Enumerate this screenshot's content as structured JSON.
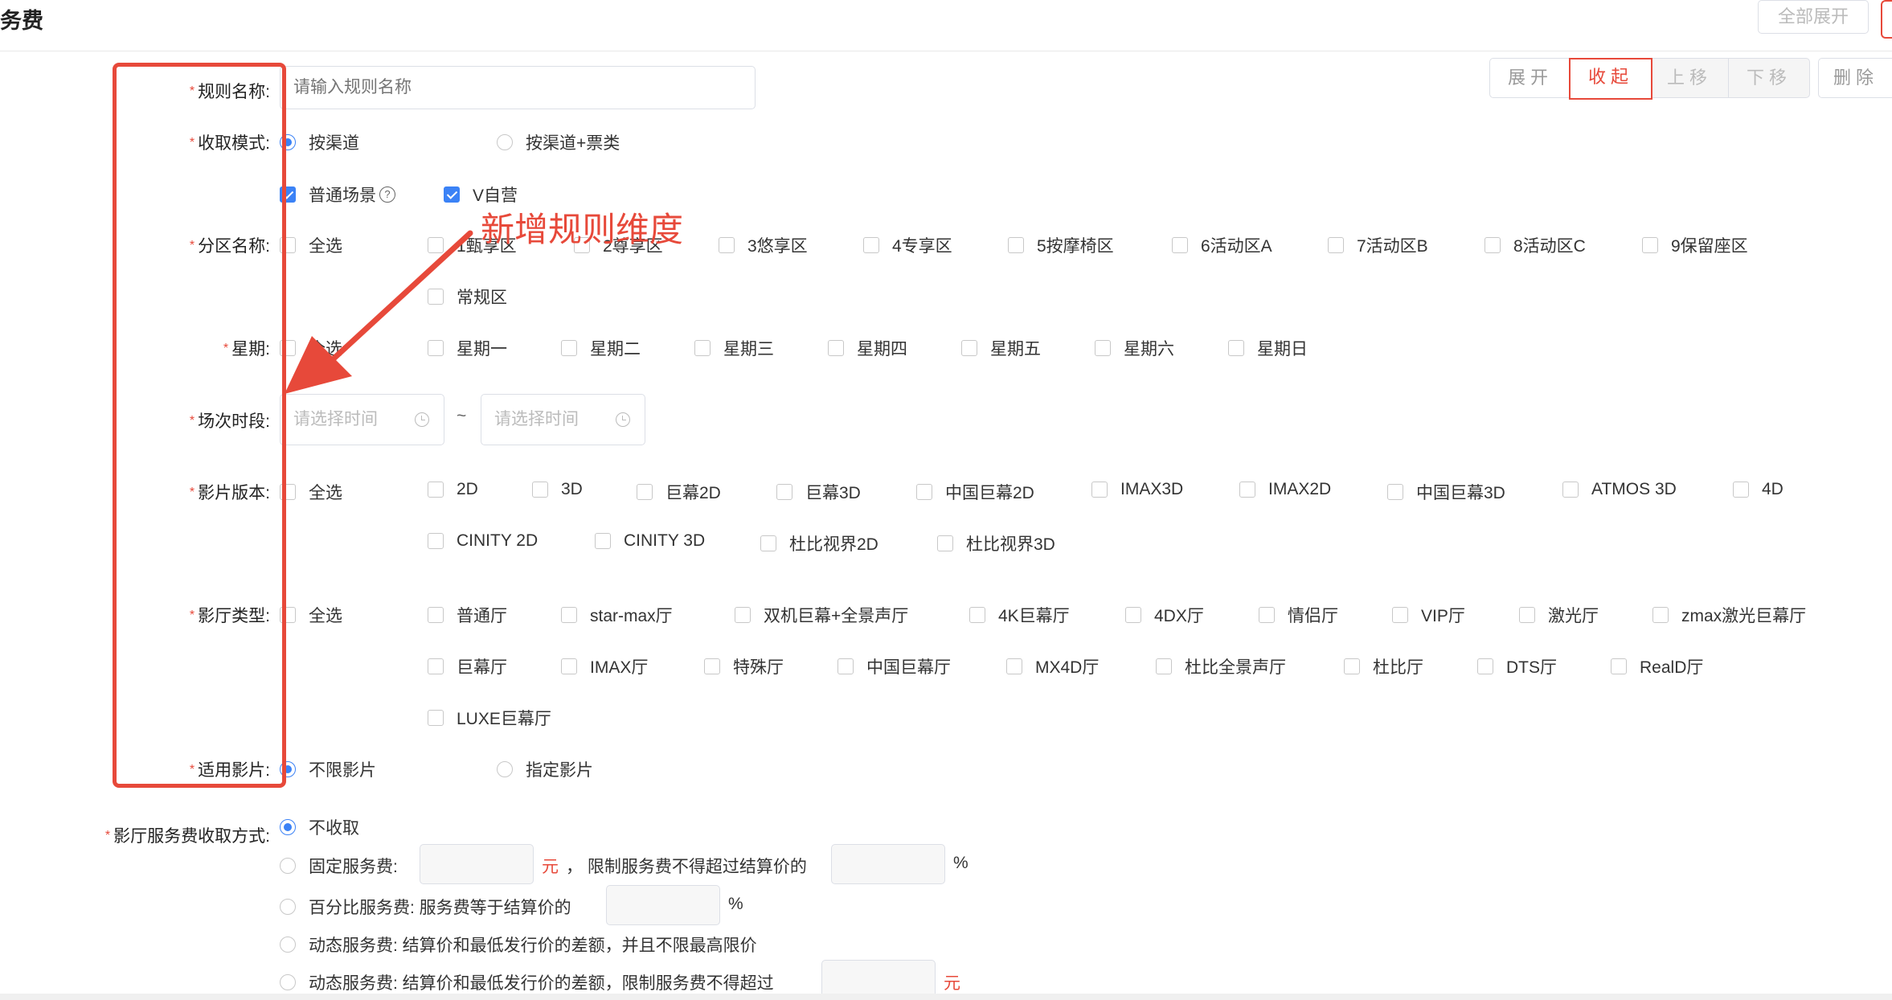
{
  "header": {
    "title": "务费",
    "expand_all": "全部展开"
  },
  "actions": {
    "expand": "展开",
    "collapse": "收起",
    "move_up": "上移",
    "move_down": "下移",
    "delete": "删除"
  },
  "rule_name": {
    "label": "规则名称:",
    "placeholder": "请输入规则名称"
  },
  "mode": {
    "label": "收取模式:",
    "options": [
      "按渠道",
      "按渠道+票类"
    ],
    "selected": "按渠道"
  },
  "scenes": {
    "normal": "普通场景",
    "self": "V自营"
  },
  "zone": {
    "label": "分区名称:",
    "options": [
      "全选",
      "1甄享区",
      "2尊享区",
      "3悠享区",
      "4专享区",
      "5按摩椅区",
      "6活动区A",
      "7活动区B",
      "8活动区C",
      "9保留座区",
      "常规区"
    ]
  },
  "week": {
    "label": "星期:",
    "options": [
      "全选",
      "星期一",
      "星期二",
      "星期三",
      "星期四",
      "星期五",
      "星期六",
      "星期日"
    ]
  },
  "session": {
    "label": "场次时段:",
    "start_placeholder": "请选择时间",
    "end_placeholder": "请选择时间",
    "separator": "~"
  },
  "film_version": {
    "label": "影片版本:",
    "options": [
      "全选",
      "2D",
      "3D",
      "巨幕2D",
      "巨幕3D",
      "中国巨幕2D",
      "IMAX3D",
      "IMAX2D",
      "中国巨幕3D",
      "ATMOS 3D",
      "4D",
      "CINITY 2D",
      "CINITY 3D",
      "杜比视界2D",
      "杜比视界3D"
    ]
  },
  "hall_type": {
    "label": "影厅类型:",
    "options": [
      "全选",
      "普通厅",
      "star-max厅",
      "双机巨幕+全景声厅",
      "4K巨幕厅",
      "4DX厅",
      "情侣厅",
      "VIP厅",
      "激光厅",
      "zmax激光巨幕厅",
      "巨幕厅",
      "IMAX厅",
      "特殊厅",
      "中国巨幕厅",
      "MX4D厅",
      "杜比全景声厅",
      "杜比厅",
      "DTS厅",
      "RealD厅",
      "LUXE巨幕厅"
    ]
  },
  "applicable": {
    "label": "适用影片:",
    "options": [
      "不限影片",
      "指定影片"
    ],
    "selected": "不限影片"
  },
  "annotation": "新增规则维度",
  "fee": {
    "label": "影厅服务费收取方式:",
    "none": "不收取",
    "fixed_label": "固定服务费:",
    "fixed_unit": "元",
    "fixed_limit": "， 限制服务费不得超过结算价的",
    "percent_sign": "%",
    "percent_label": "百分比服务费:  服务费等于结算价的",
    "dynamic1": "动态服务费:  结算价和最低发行价的差额，并且不限最高限价",
    "dynamic2": "动态服务费:  结算价和最低发行价的差额，限制服务费不得超过",
    "dynamic2_unit": "元"
  },
  "colors": {
    "accent": "#3b82f6",
    "required": "#e7493a",
    "annotation": "#e7493a"
  }
}
